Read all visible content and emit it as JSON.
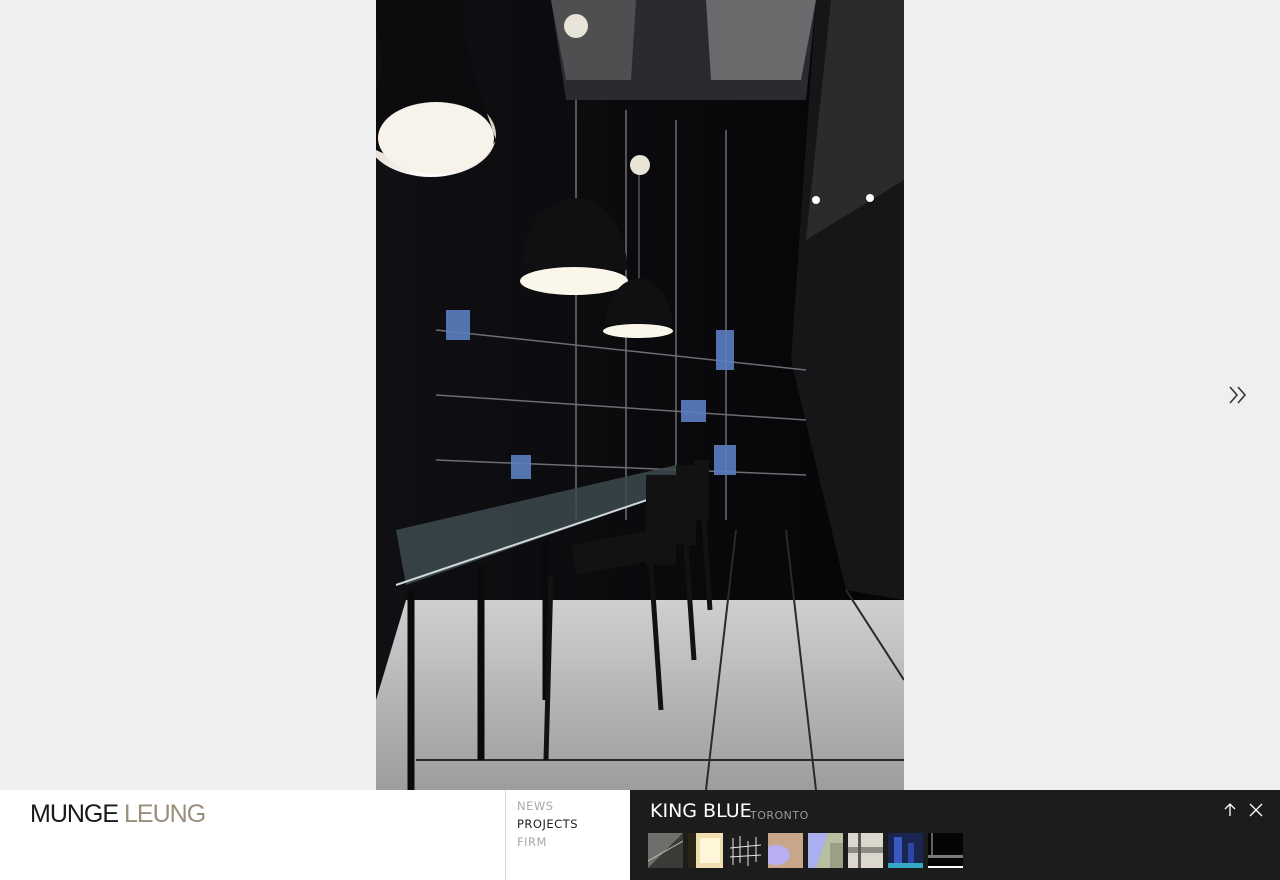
{
  "brand": {
    "part1": "MUNGE",
    "part2": "LEUNG"
  },
  "nav": {
    "items": [
      {
        "label": "NEWS",
        "active": false
      },
      {
        "label": "PROJECTS",
        "active": true
      },
      {
        "label": "FIRM",
        "active": false
      }
    ]
  },
  "project": {
    "title": "KING BLUE",
    "location": "TORONTO",
    "thumbnail_count": 8,
    "active_thumbnail": 8
  },
  "icons": {
    "next": "double-chevron-right-icon",
    "up": "arrow-up-icon",
    "close": "close-icon"
  },
  "colors": {
    "background": "#efefef",
    "panel": "#1c1c1c",
    "brand_secondary": "#9a8f7c"
  }
}
